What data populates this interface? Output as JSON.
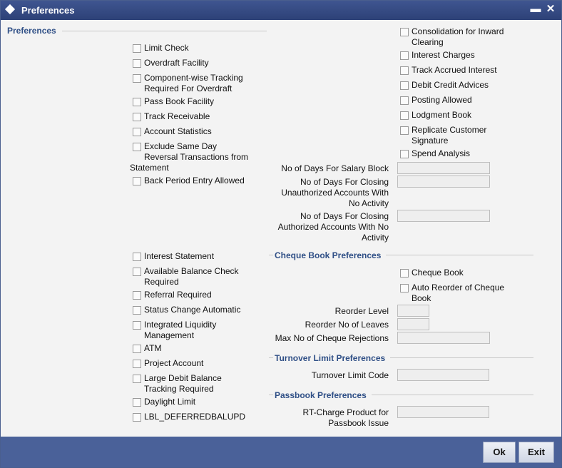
{
  "window": {
    "title": "Preferences",
    "minimize": "▬",
    "close": "✕"
  },
  "sections": {
    "preferences": "Preferences",
    "cheque_book": "Cheque Book Preferences",
    "turnover": "Turnover Limit Preferences",
    "passbook": "Passbook Preferences"
  },
  "left_checks_top": [
    "Limit Check",
    "Overdraft Facility",
    "Component-wise Tracking\nRequired For Overdraft",
    "Pass Book Facility",
    "Track Receivable",
    "Account Statistics",
    "Exclude Same Day\nReversal Transactions from",
    "Statement",
    "Back Period Entry Allowed"
  ],
  "left_checks_bottom": [
    "Interest Statement",
    "Available Balance Check\nRequired",
    "Referral Required",
    "Status Change Automatic",
    "Integrated Liquidity\nManagement",
    "ATM",
    "Project Account",
    "Large Debit Balance\nTracking Required",
    "Daylight Limit",
    "LBL_DEFERREDBALUPD"
  ],
  "right_checks": [
    "Consolidation for Inward\nClearing",
    "Interest Charges",
    "Track Accrued Interest",
    "Debit Credit Advices",
    "Posting Allowed",
    "Lodgment Book",
    "Replicate Customer\nSignature",
    "Spend Analysis"
  ],
  "fields": {
    "salary_block": {
      "label": "No of Days For Salary Block",
      "value": ""
    },
    "closing_unauth": {
      "label": "No of Days For Closing\nUnauthorized Accounts With\nNo Activity",
      "value": ""
    },
    "closing_auth": {
      "label": "No of Days For Closing\nAuthorized Accounts With No\nActivity",
      "value": ""
    }
  },
  "cheque": {
    "cheque_book": "Cheque Book",
    "auto_reorder": "Auto Reorder of Cheque\nBook",
    "reorder_level": {
      "label": "Reorder Level",
      "value": ""
    },
    "reorder_leaves": {
      "label": "Reorder No of Leaves",
      "value": ""
    },
    "max_rejections": {
      "label": "Max No of Cheque Rejections",
      "value": ""
    }
  },
  "turnover": {
    "label": "Turnover Limit Code",
    "value": ""
  },
  "passbook": {
    "label": "RT-Charge Product for\nPassbook Issue",
    "value": ""
  },
  "buttons": {
    "ok": "Ok",
    "exit": "Exit"
  }
}
